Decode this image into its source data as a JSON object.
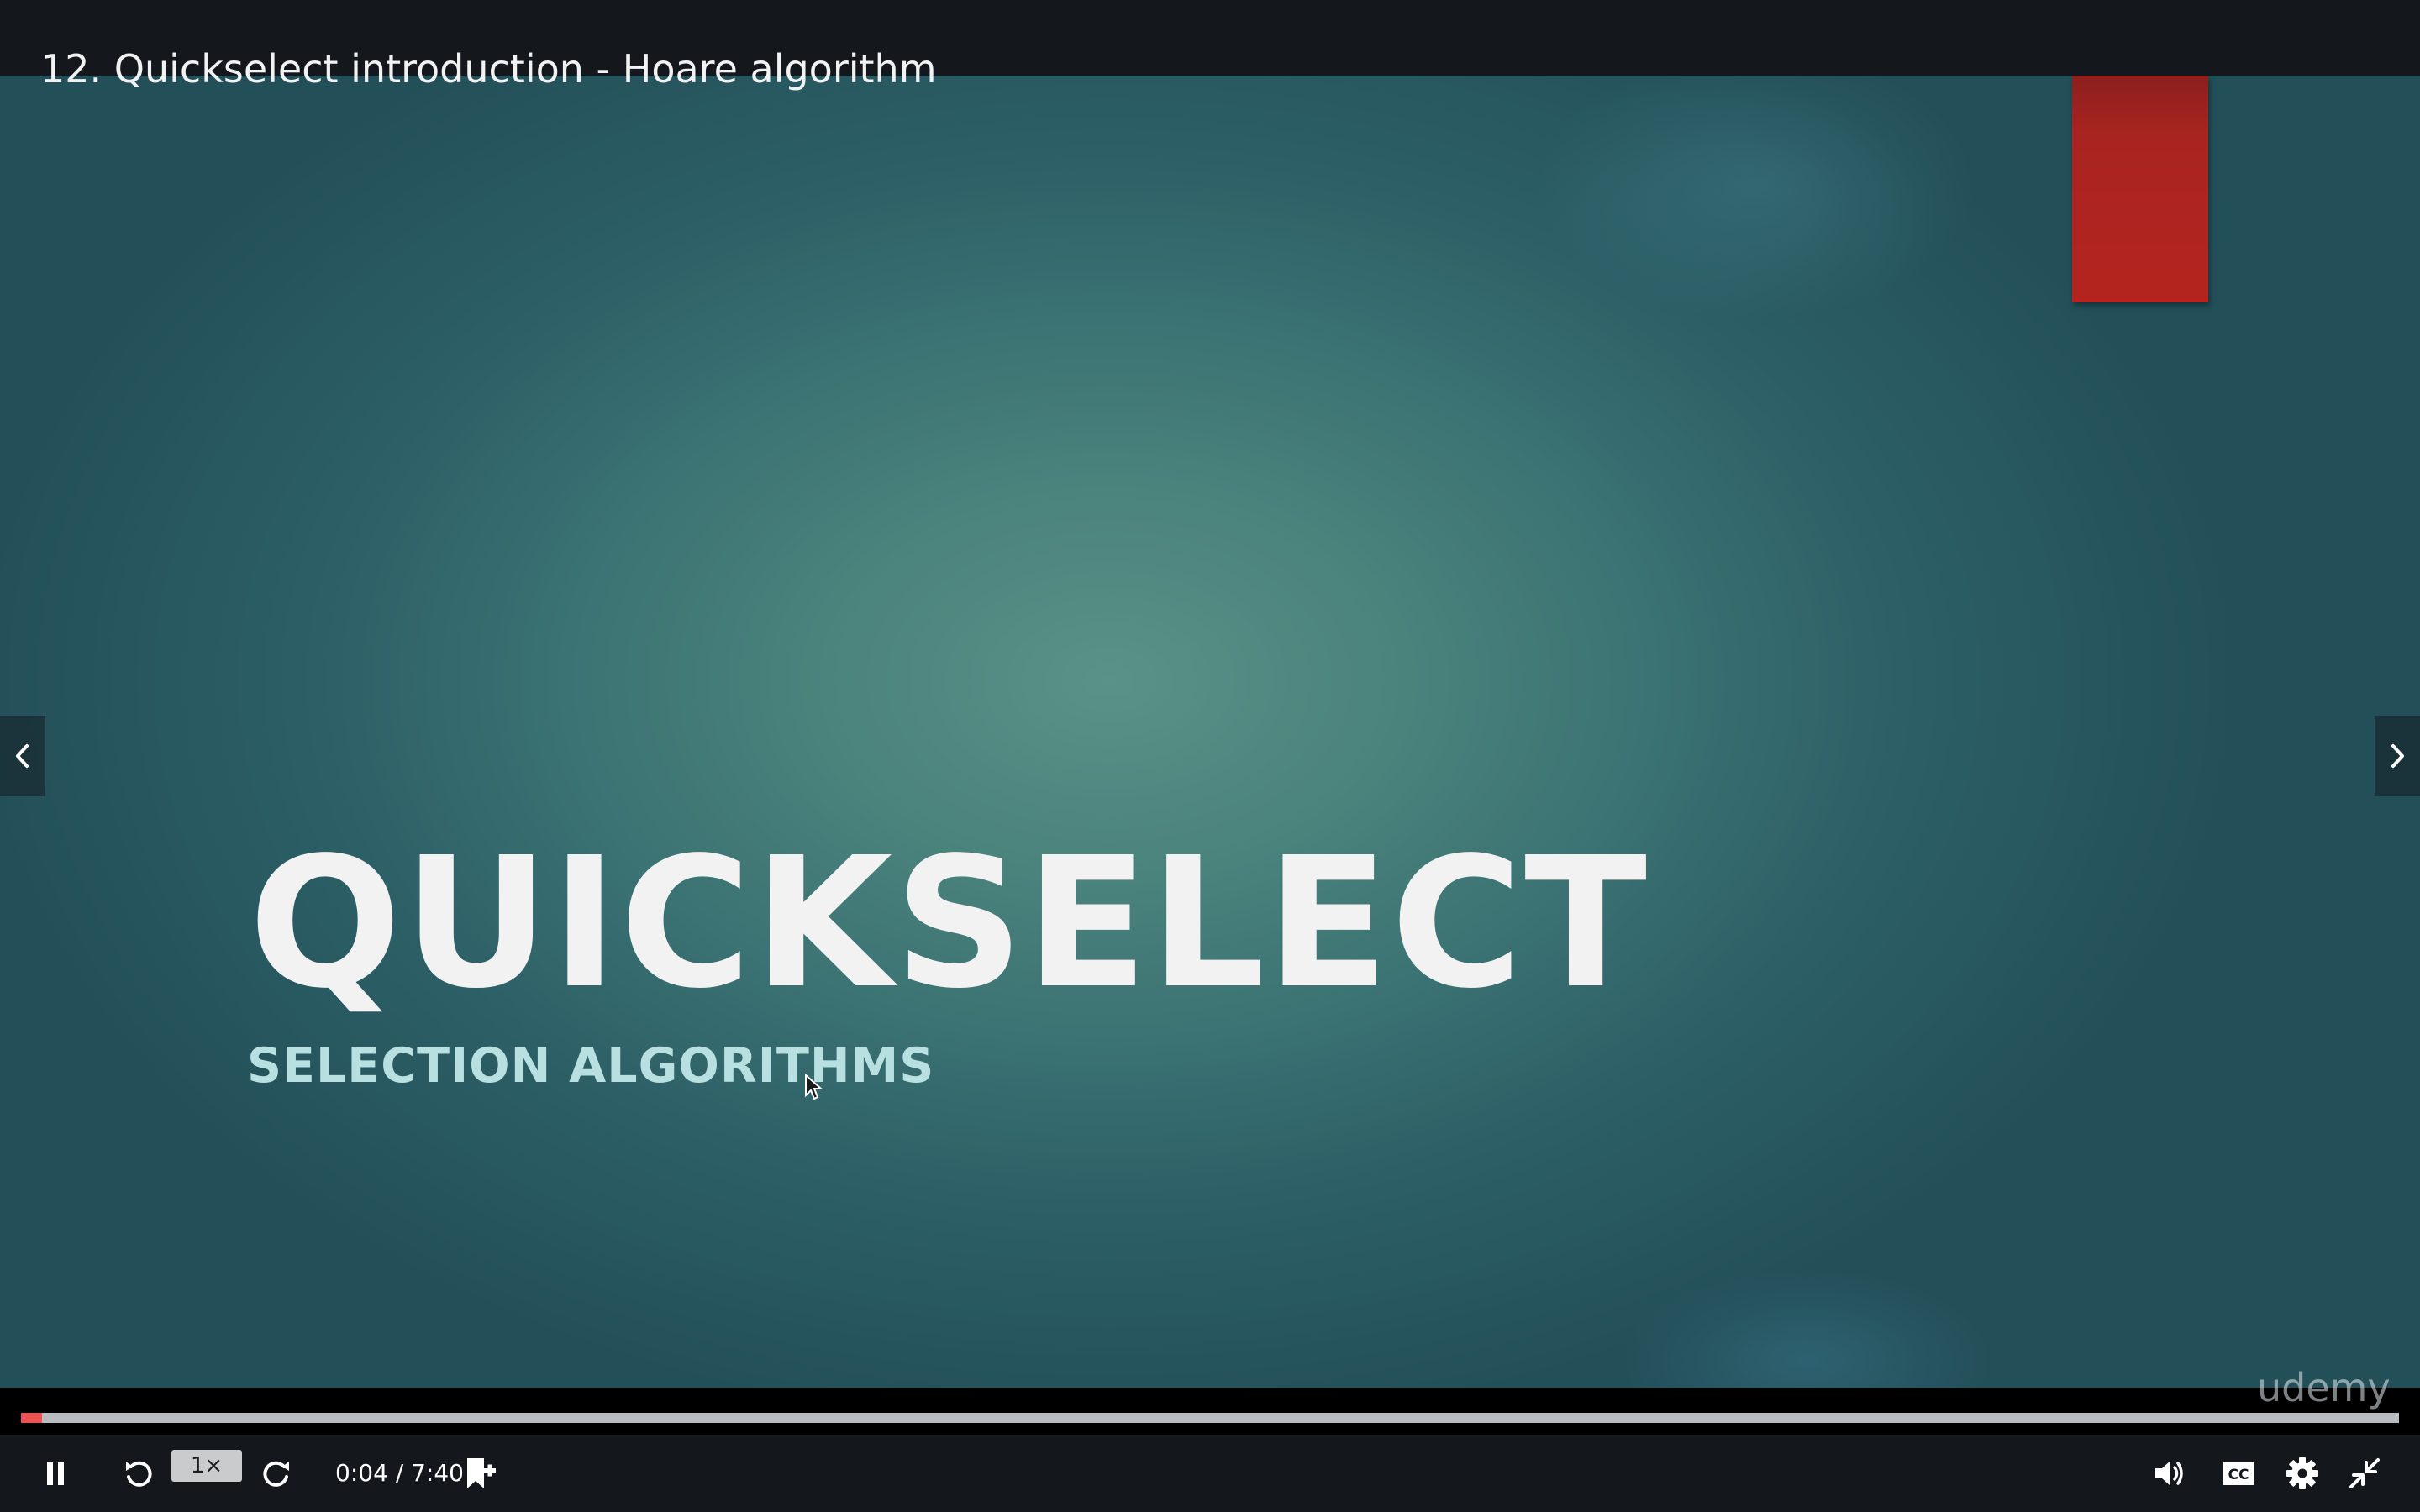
{
  "header": {
    "lecture_title": "12. Quickselect introduction - Hoare algorithm"
  },
  "slide": {
    "title": "QUICKSELECT",
    "subtitle": "SELECTION ALGORITHMS"
  },
  "watermark": "udemy",
  "player": {
    "speed_label": "1×",
    "current_time": "0:04",
    "duration": "7:40",
    "time_text": "0:04 / 7:40",
    "progress_fraction": 0.0087,
    "controls": {
      "left": [
        "pause-icon",
        "rewind-icon",
        "speed-button",
        "forward-icon",
        "time-display",
        "add-bookmark-icon"
      ],
      "right": [
        "volume-icon",
        "captions-icon",
        "settings-icon",
        "exit-fullscreen-icon"
      ]
    }
  },
  "colors": {
    "progress_fill": "#ec5252",
    "progress_track": "#b8bcc0",
    "accent_red": "#b5241f",
    "slide_subtitle": "#b9e0e0"
  }
}
